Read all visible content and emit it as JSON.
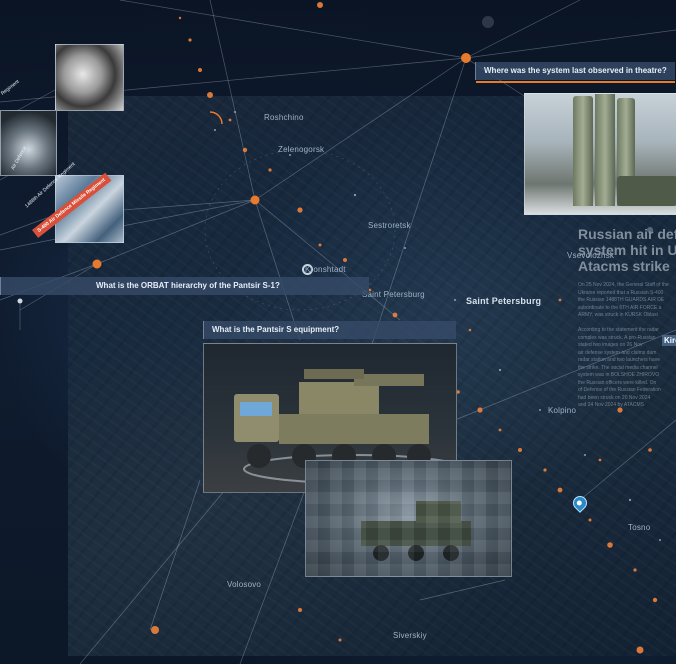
{
  "questions": {
    "last_observed": "Where was the system last observed in theatre?",
    "orbat": "What is the ORBAT hierarchy of the Pantsir S-1?",
    "equipment": "What is the Pantsir S equipment?"
  },
  "map_labels": {
    "roshchino": "Roshchino",
    "zelenogorsk": "Zelenogorsk",
    "sestroretsk": "Sestroretsk",
    "kronshtadt": "Kronshtadt",
    "saint_petersburg_1": "Saint Petersburg",
    "saint_petersburg_2": "Saint Petersburg",
    "vsevolozhsk": "Vsevolozhsk",
    "kolpino": "Kolpino",
    "tosno": "Tosno",
    "volosovo": "Volosovo",
    "siverskiy": "Siverskiy",
    "kirov": "Kiro"
  },
  "article": {
    "headline_line1": "Russian air defe",
    "headline_line2": "system hit in Uk",
    "headline_line3": "Atacms strike",
    "paragraph_lines": [
      "On 25 Nov 2024, the General Staff of the",
      "Ukraine reported that a Russian S-400",
      "the Russian 1488TH GUARDS AIR DE",
      "subordinate to the 6TH AIR FORCE a",
      "ARMY, was struck in KURSK Oblast",
      "",
      "According to the statement the radar",
      "complex was struck. A pro-Russian",
      "stated two images on 26 Nov",
      "air defense system and claims dam",
      "radar station and two launchers have",
      "the strike. The social media channel",
      "system was in BOLSHOE ZHIROVO",
      "the Russian officers were killed. On",
      "of Defence of the Russian Federation",
      "had been struck on 20 Nov 2024",
      "and 24 Nov 2024 by ATACMS"
    ]
  },
  "diagonal_labels": {
    "label_a": "Regiment",
    "label_b": "Air Defence",
    "label_c": "1488th Air Defence Regiment",
    "tag": "S-400 Air Defence Missile Regiment"
  },
  "colors": {
    "accent": "#e87a2e",
    "node": "#e87a2e",
    "query_bg": "#364a68",
    "tag": "#d9503a"
  }
}
